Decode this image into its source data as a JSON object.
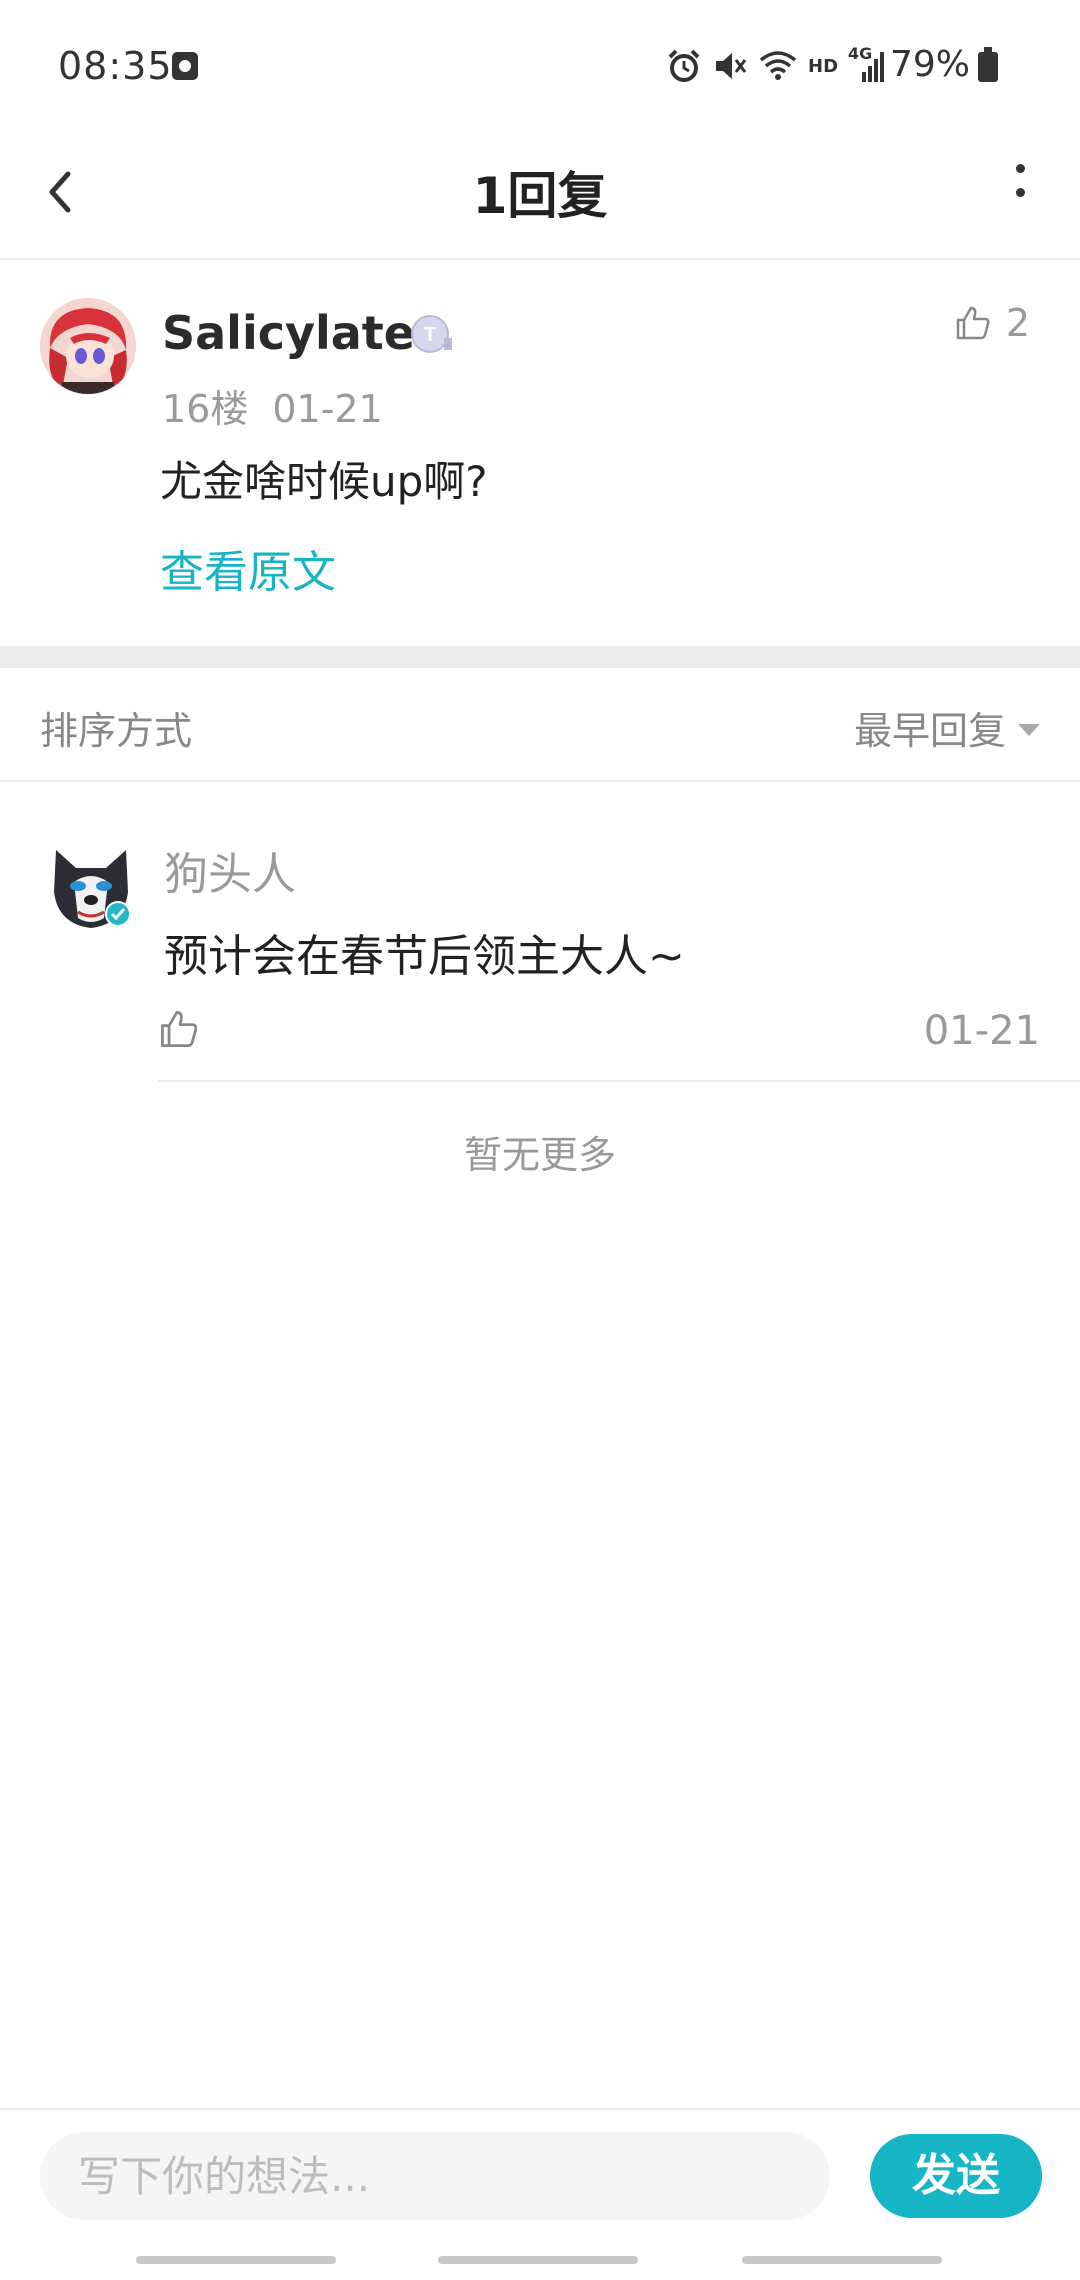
{
  "status_bar": {
    "time": "08:35",
    "battery": "79%",
    "network": "4G",
    "hd": "HD"
  },
  "header": {
    "title": "1回复"
  },
  "post": {
    "username": "Salicylates",
    "floor": "16楼",
    "date": "01-21",
    "text": "尤金啥时候up啊?",
    "view_original": "查看原文",
    "like_count": "2"
  },
  "sort": {
    "label": "排序方式",
    "selected": "最早回复"
  },
  "replies": [
    {
      "username": "狗头人",
      "text": "预计会在春节后领主大人~",
      "date": "01-21"
    }
  ],
  "no_more": "暂无更多",
  "composer": {
    "placeholder": "写下你的想法...",
    "send_label": "发送"
  },
  "colors": {
    "accent": "#16b6c6",
    "link": "#18b4c4"
  }
}
